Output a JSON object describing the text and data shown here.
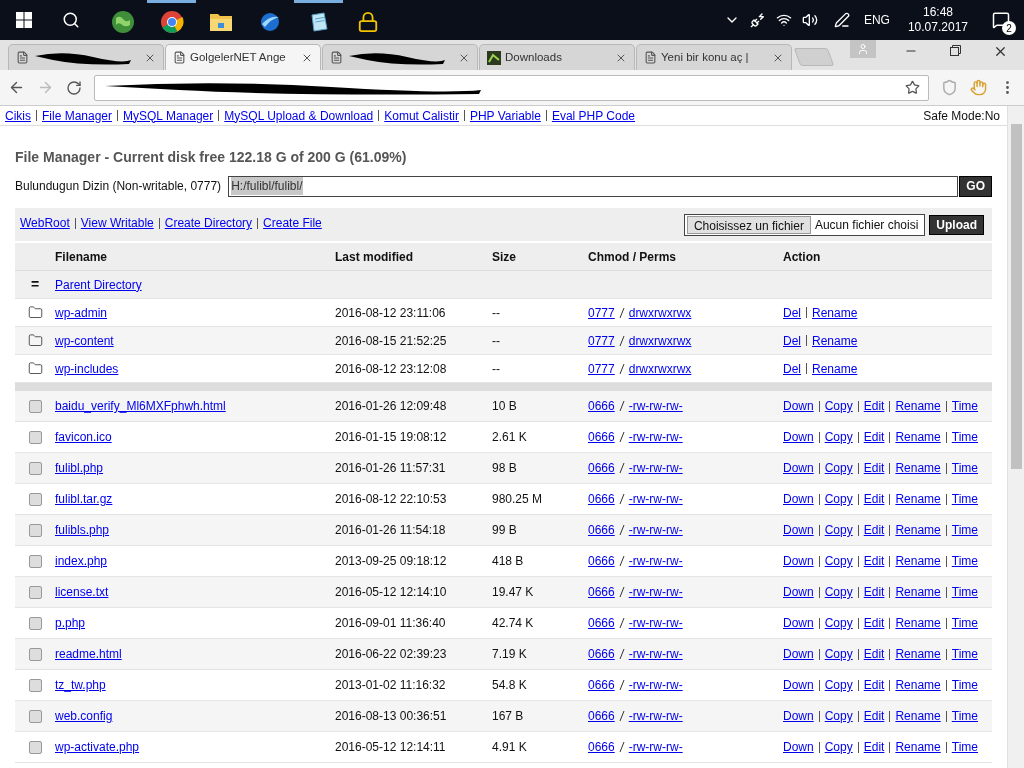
{
  "taskbar": {
    "apps": [
      {
        "kind": "globe",
        "running": false
      },
      {
        "kind": "chrome",
        "running": true
      },
      {
        "kind": "folder",
        "running": false
      },
      {
        "kind": "orb",
        "running": false
      },
      {
        "kind": "notepad",
        "running": true
      },
      {
        "kind": "lock",
        "running": false
      }
    ],
    "tray": {
      "language": "ENG",
      "time": "16:48",
      "date": "10.07.2017",
      "notifications": "2"
    }
  },
  "browser": {
    "tabs": [
      {
        "kind": "page",
        "redacted": true,
        "selected": false
      },
      {
        "kind": "page",
        "title": "GolgelerNET Ange",
        "redacted": false,
        "selected": true
      },
      {
        "kind": "page",
        "redacted": true,
        "selected": false
      },
      {
        "kind": "downloads",
        "title": "Downloads",
        "redacted": false,
        "selected": false
      },
      {
        "kind": "page",
        "title": "Yeni bir konu aç |",
        "redacted": false,
        "selected": false
      }
    ],
    "address": {
      "redacted": true
    }
  },
  "menu": {
    "links": [
      "Cikis",
      "File Manager",
      "MySQL Manager",
      "MySQL Upload & Download",
      "Komut Calistir",
      "PHP Variable",
      "Eval PHP Code"
    ],
    "safe_mode": "Safe Mode:No"
  },
  "file_manager": {
    "title": "File Manager - Current disk free 122.18 G of 200 G (61.09%)",
    "dir_label": "Bulundugun Dizin (Non-writable, 0777)",
    "dir_value": "H:/fulibl/fulibl/",
    "go": "GO",
    "tools": [
      "WebRoot",
      "View Writable",
      "Create Directory",
      "Create File"
    ],
    "file_button": "Choisissez un fichier",
    "file_status": "Aucun fichier choisi",
    "upload": "Upload",
    "columns": [
      "Filename",
      "Last modified",
      "Size",
      "Chmod / Perms",
      "Action"
    ],
    "rows": [
      {
        "kind": "parent",
        "marker": "=",
        "name": "Parent Directory"
      },
      {
        "kind": "dir",
        "name": "wp-admin",
        "modified": "2016-08-12 23:11:06",
        "size": "--",
        "mode": "0777",
        "perms": "drwxrwxrwx",
        "actions": [
          "Del",
          "Rename"
        ]
      },
      {
        "kind": "dir",
        "name": "wp-content",
        "modified": "2016-08-15 21:52:25",
        "size": "--",
        "mode": "0777",
        "perms": "drwxrwxrwx",
        "actions": [
          "Del",
          "Rename"
        ]
      },
      {
        "kind": "dir",
        "name": "wp-includes",
        "modified": "2016-08-12 23:12:08",
        "size": "--",
        "mode": "0777",
        "perms": "drwxrwxrwx",
        "actions": [
          "Del",
          "Rename"
        ]
      },
      {
        "kind": "gap"
      },
      {
        "kind": "file",
        "checked": false,
        "name": "baidu_verify_Ml6MXFphwh.html",
        "modified": "2016-01-26 12:09:48",
        "size": "10 B",
        "mode": "0666",
        "perms": "-rw-rw-rw-",
        "actions": [
          "Down",
          "Copy",
          "Edit",
          "Rename",
          "Time"
        ]
      },
      {
        "kind": "file",
        "checked": false,
        "name": "favicon.ico",
        "modified": "2016-01-15 19:08:12",
        "size": "2.61 K",
        "mode": "0666",
        "perms": "-rw-rw-rw-",
        "actions": [
          "Down",
          "Copy",
          "Edit",
          "Rename",
          "Time"
        ]
      },
      {
        "kind": "file",
        "checked": false,
        "name": "fulibl.php",
        "modified": "2016-01-26 11:57:31",
        "size": "98 B",
        "mode": "0666",
        "perms": "-rw-rw-rw-",
        "actions": [
          "Down",
          "Copy",
          "Edit",
          "Rename",
          "Time"
        ]
      },
      {
        "kind": "file",
        "checked": false,
        "name": "fulibl.tar.gz",
        "modified": "2016-08-12 22:10:53",
        "size": "980.25 M",
        "mode": "0666",
        "perms": "-rw-rw-rw-",
        "actions": [
          "Down",
          "Copy",
          "Edit",
          "Rename",
          "Time"
        ]
      },
      {
        "kind": "file",
        "checked": false,
        "name": "fulibls.php",
        "modified": "2016-01-26 11:54:18",
        "size": "99 B",
        "mode": "0666",
        "perms": "-rw-rw-rw-",
        "actions": [
          "Down",
          "Copy",
          "Edit",
          "Rename",
          "Time"
        ]
      },
      {
        "kind": "file",
        "checked": false,
        "name": "index.php",
        "modified": "2013-09-25 09:18:12",
        "size": "418 B",
        "mode": "0666",
        "perms": "-rw-rw-rw-",
        "actions": [
          "Down",
          "Copy",
          "Edit",
          "Rename",
          "Time"
        ]
      },
      {
        "kind": "file",
        "checked": false,
        "name": "license.txt",
        "modified": "2016-05-12 12:14:10",
        "size": "19.47 K",
        "mode": "0666",
        "perms": "-rw-rw-rw-",
        "actions": [
          "Down",
          "Copy",
          "Edit",
          "Rename",
          "Time"
        ]
      },
      {
        "kind": "file",
        "checked": false,
        "name": "p.php",
        "modified": "2016-09-01 11:36:40",
        "size": "42.74 K",
        "mode": "0666",
        "perms": "-rw-rw-rw-",
        "actions": [
          "Down",
          "Copy",
          "Edit",
          "Rename",
          "Time"
        ]
      },
      {
        "kind": "file",
        "checked": false,
        "name": "readme.html",
        "modified": "2016-06-22 02:39:23",
        "size": "7.19 K",
        "mode": "0666",
        "perms": "-rw-rw-rw-",
        "actions": [
          "Down",
          "Copy",
          "Edit",
          "Rename",
          "Time"
        ]
      },
      {
        "kind": "file",
        "checked": false,
        "name": "tz_tw.php",
        "modified": "2013-01-02 11:16:32",
        "size": "54.8 K",
        "mode": "0666",
        "perms": "-rw-rw-rw-",
        "actions": [
          "Down",
          "Copy",
          "Edit",
          "Rename",
          "Time"
        ]
      },
      {
        "kind": "file",
        "checked": false,
        "name": "web.config",
        "modified": "2016-08-13 00:36:51",
        "size": "167 B",
        "mode": "0666",
        "perms": "-rw-rw-rw-",
        "actions": [
          "Down",
          "Copy",
          "Edit",
          "Rename",
          "Time"
        ]
      },
      {
        "kind": "file",
        "checked": false,
        "name": "wp-activate.php",
        "modified": "2016-05-12 12:14:11",
        "size": "4.91 K",
        "mode": "0666",
        "perms": "-rw-rw-rw-",
        "actions": [
          "Down",
          "Copy",
          "Edit",
          "Rename",
          "Time"
        ]
      }
    ]
  }
}
